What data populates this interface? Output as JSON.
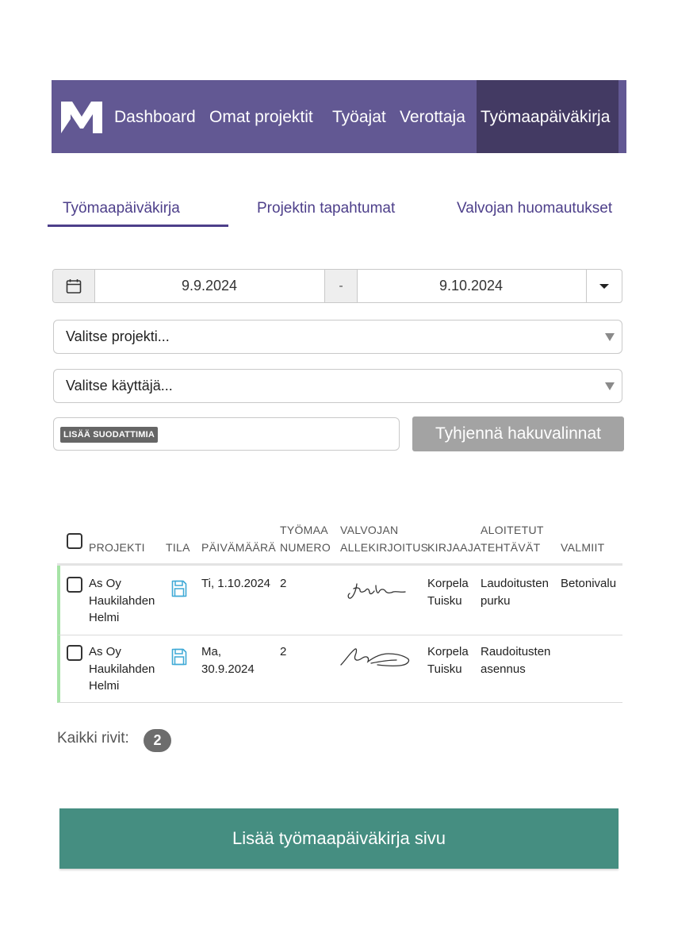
{
  "nav": {
    "items": [
      "Dashboard",
      "Omat projektit",
      "Työajat",
      "Verottaja",
      "Työmaapäiväkirja"
    ],
    "active": "Työmaapäiväkirja",
    "colors": {
      "bar": "#625893",
      "active": "#433a63"
    },
    "logo_icon": "m-logo-icon"
  },
  "tabs": [
    "Työmaapäiväkirja",
    "Projektin tapahtumat",
    "Valvojan huomautukset"
  ],
  "filters": {
    "date_from": "9.9.2024",
    "date_separator": "-",
    "date_to": "9.10.2024",
    "project_placeholder": "Valitse projekti...",
    "user_placeholder": "Valitse käyttäjä...",
    "add_filters_chip": "LISÄÄ SUODATTIMIA",
    "clear_button": "Tyhjennä hakuvalinnat"
  },
  "table": {
    "headers": {
      "projekti": "PROJEKTI",
      "tila": "TILA",
      "paivamaara": "PÄIVÄMÄÄRÄ",
      "tyomaa_numero": [
        "TYÖMAA",
        "NUMERO"
      ],
      "valvojan_allekirjoitus": [
        "VALVOJAN",
        "ALLEKIRJOITUS"
      ],
      "kirjaaja": "KIRJAAJA",
      "aloitetut_tehtavat": [
        "ALOITETUT",
        "TEHTÄVÄT"
      ],
      "valmiit": "VALMIIT"
    },
    "rows": [
      {
        "projekti": [
          "As Oy",
          "Haukilahden",
          "Helmi"
        ],
        "tila_icon": "save-icon",
        "paivamaara": [
          "Ti, 1.10.2024"
        ],
        "tyomaa_numero": "2",
        "signature_icon": "signature-icon",
        "kirjaaja": [
          "Korpela",
          "Tuisku"
        ],
        "aloitetut": [
          "Laudoitusten",
          "purku"
        ],
        "valmiit": "Betonivalu"
      },
      {
        "projekti": [
          "As Oy",
          "Haukilahden",
          "Helmi"
        ],
        "tila_icon": "save-icon",
        "paivamaara": [
          "Ma,",
          "30.9.2024"
        ],
        "tyomaa_numero": "2",
        "signature_icon": "signature-icon",
        "kirjaaja": [
          "Korpela",
          "Tuisku"
        ],
        "aloitetut": [
          "Raudoitusten",
          "asennus"
        ],
        "valmiit": ""
      }
    ]
  },
  "summary": {
    "label": "Kaikki rivit:",
    "count": "2"
  },
  "add_button": "Lisää työmaapäiväkirja sivu",
  "colors": {
    "accent": "#4d3f8a",
    "row_marker": "#a6e3a6",
    "save_icon": "#3fa9d6",
    "primary_button": "#458e81"
  }
}
